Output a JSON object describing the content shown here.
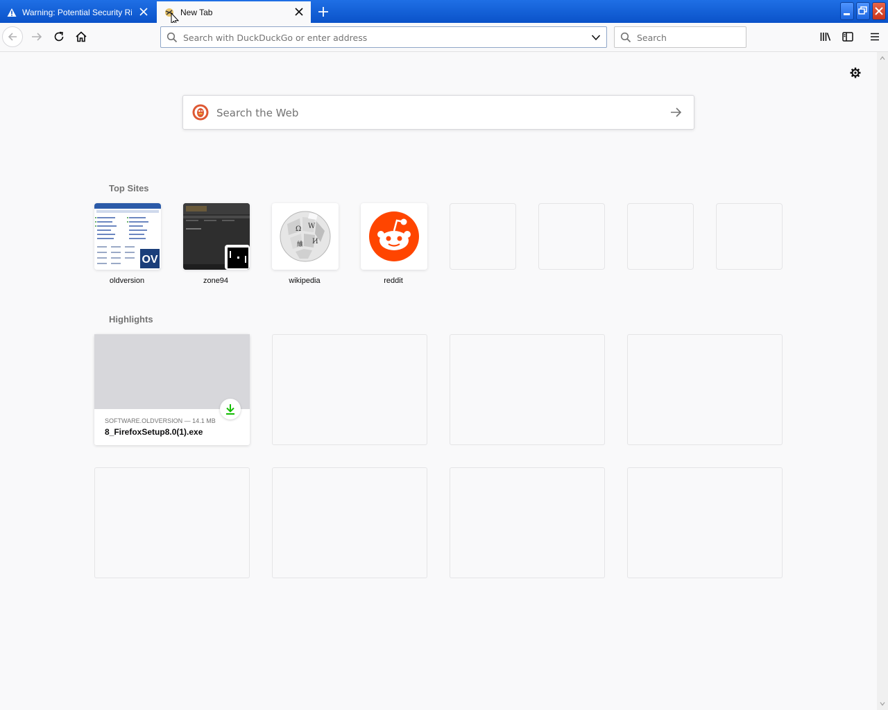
{
  "tabs": [
    {
      "title": "Warning: Potential Security Risk Ahead",
      "active": false
    },
    {
      "title": "New Tab",
      "active": true
    }
  ],
  "urlbar": {
    "placeholder": "Search with DuckDuckGo or enter address"
  },
  "searchbar": {
    "placeholder": "Search"
  },
  "websearch": {
    "placeholder": "Search the Web"
  },
  "top_sites": {
    "heading": "Top Sites",
    "items": [
      {
        "label": "oldversion",
        "badge": "OV"
      },
      {
        "label": "zone94"
      },
      {
        "label": "wikipedia"
      },
      {
        "label": "reddit"
      }
    ]
  },
  "highlights": {
    "heading": "Highlights",
    "items": [
      {
        "host": "SOFTWARE.OLDVERSION — 14.1 MB",
        "title": "8_FirefoxSetup8.0(1).exe"
      }
    ]
  },
  "colors": {
    "titlebar": "#0a52c9",
    "reddit": "#ff4500",
    "download": "#12bc00"
  }
}
